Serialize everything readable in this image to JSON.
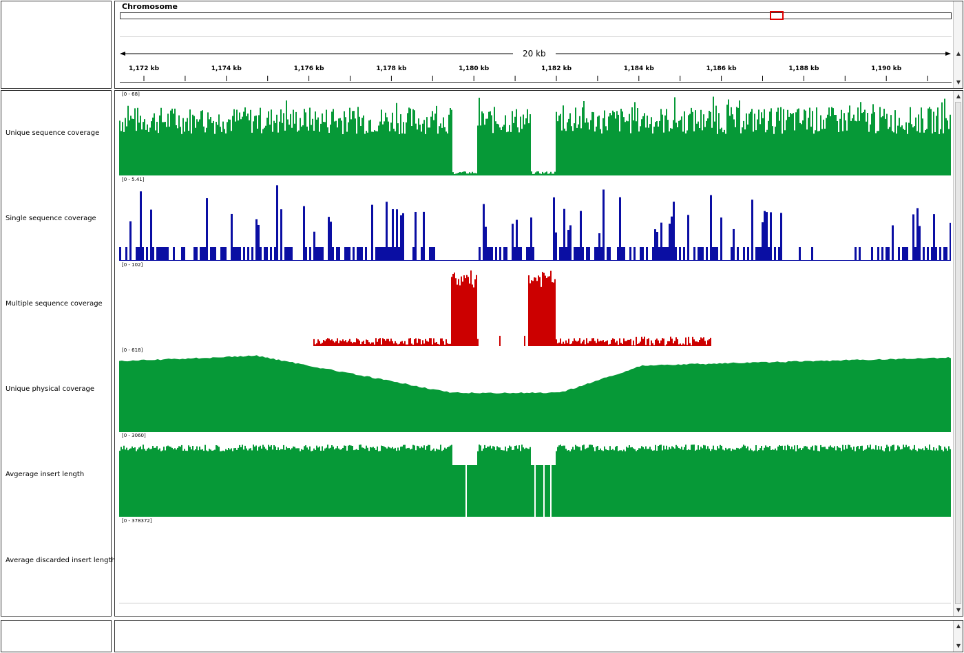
{
  "header": {
    "chromosome_label": "Chromosome",
    "span_label": "20 kb",
    "ticks": [
      "1,172 kb",
      "1,174 kb",
      "1,176 kb",
      "1,178 kb",
      "1,180 kb",
      "1,182 kb",
      "1,184 kb",
      "1,186 kb",
      "1,188 kb",
      "1,190 kb"
    ]
  },
  "colors": {
    "green": "#069937",
    "blue": "#0a0ea3",
    "red": "#cc0000",
    "region_marker": "#e00000"
  },
  "tracks": [
    {
      "name": "Unique sequence coverage",
      "range": "[0 - 68]",
      "color": "green"
    },
    {
      "name": "Single sequence coverage",
      "range": "[0 - 5.41]",
      "color": "blue"
    },
    {
      "name": "Multiple sequence coverage",
      "range": "[0 - 102]",
      "color": "red"
    },
    {
      "name": "Unique physical coverage",
      "range": "[0 - 618]",
      "color": "green"
    },
    {
      "name": "Avgerage insert length",
      "range": "[0 - 3060]",
      "color": "green"
    },
    {
      "name": "Average discarded insert length",
      "range": "[0 - 378372]",
      "color": "none"
    }
  ],
  "icons": {
    "scroll_up": "▲",
    "scroll_down": "▼"
  }
}
